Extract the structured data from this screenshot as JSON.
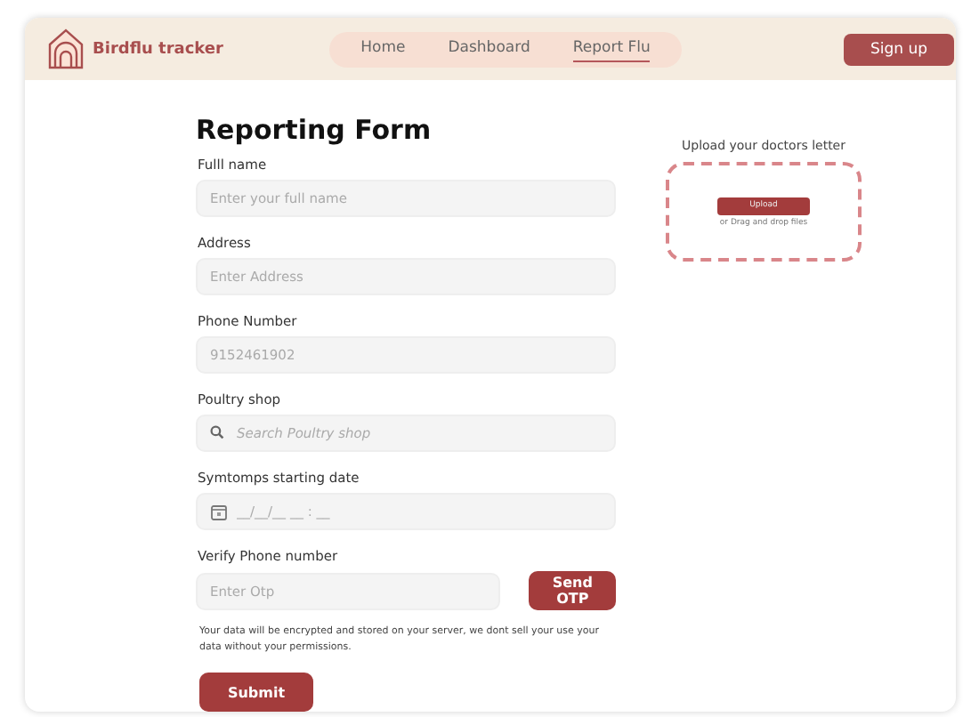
{
  "header": {
    "brand": "Birdflu tracker",
    "nav": [
      {
        "label": "Home",
        "selected": false
      },
      {
        "label": "Dashboard",
        "selected": false
      },
      {
        "label": "Report Flu",
        "selected": true
      }
    ],
    "signup": "Sign up"
  },
  "form": {
    "title": "Reporting Form",
    "fields": [
      {
        "kind": "text",
        "label": "Fulll name",
        "placeholder": "Enter your full name"
      },
      {
        "kind": "text",
        "label": "Address",
        "placeholder": "Enter Address"
      },
      {
        "kind": "text",
        "label": "Phone Number",
        "placeholder": "9152461902"
      },
      {
        "kind": "search",
        "label": "Poultry shop",
        "placeholder": "Search Poultry shop"
      },
      {
        "kind": "date",
        "label": "Symtomps starting date",
        "placeholder": "__/__/__ __ : __"
      }
    ],
    "verify": {
      "label": "Verify Phone number",
      "placeholder": "Enter Otp",
      "button": "Send OTP"
    },
    "note": "Your data will be encrypted and stored on your server, we dont sell your use your data without your permissions.",
    "submit": "Submit"
  },
  "upload": {
    "title": "Upload your doctors letter",
    "button": "Upload",
    "hint": "or Drag and drop files"
  }
}
